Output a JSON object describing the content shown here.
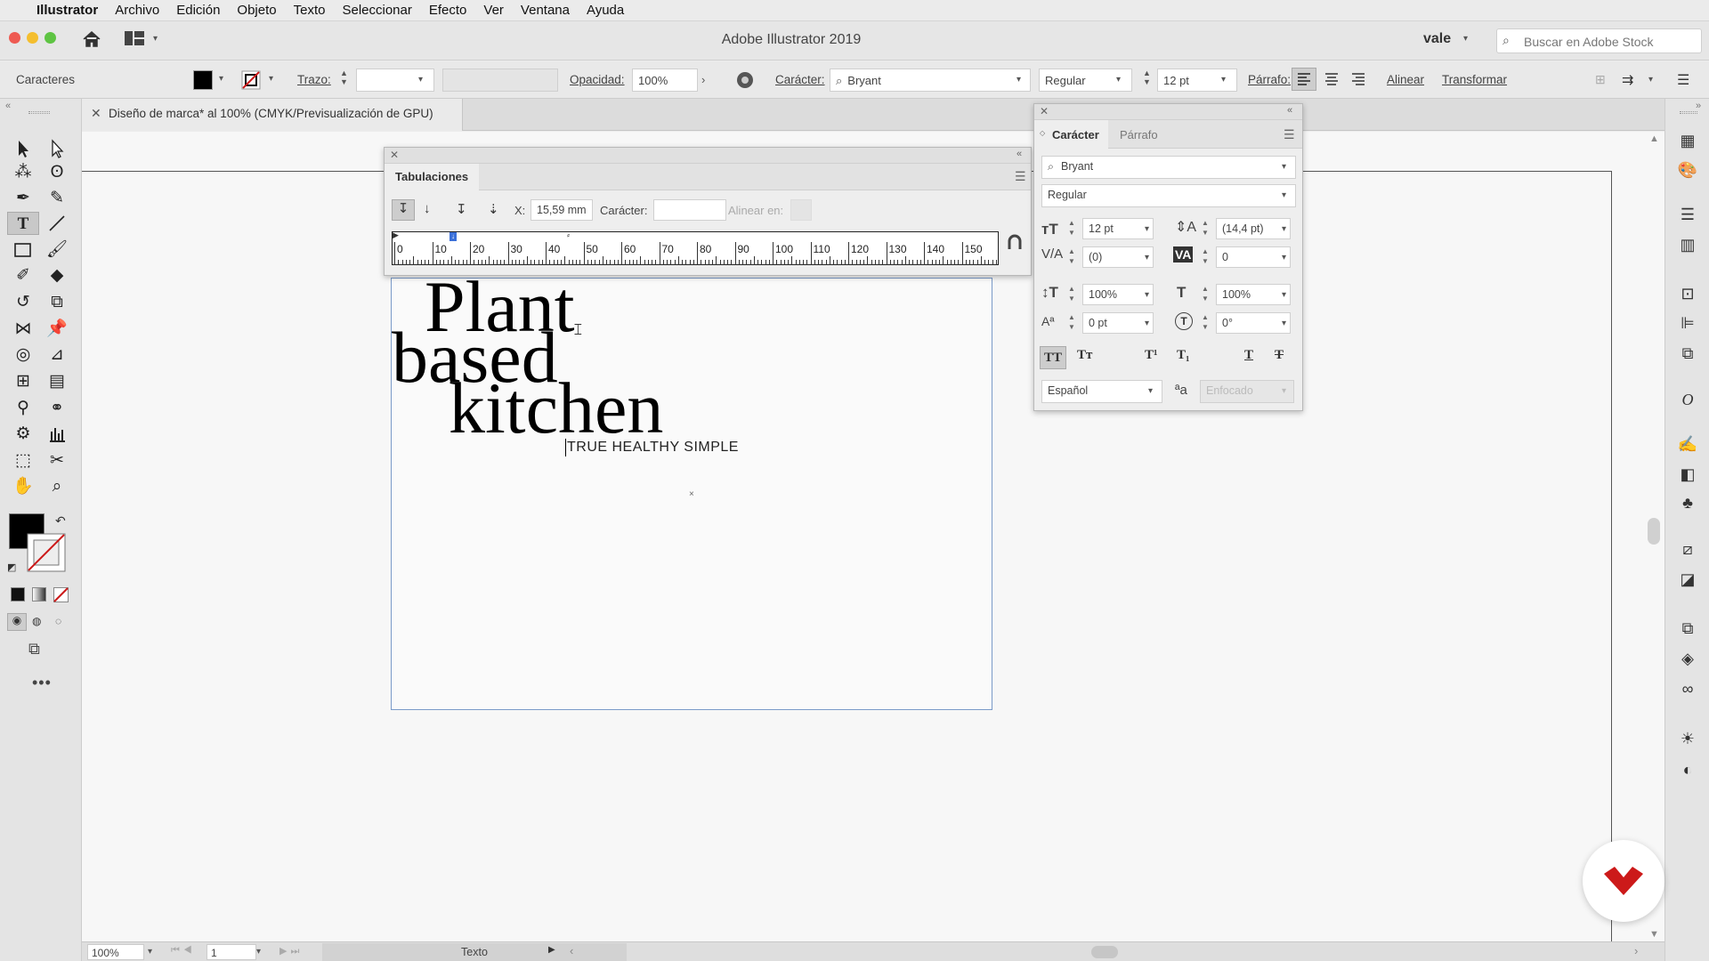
{
  "menubar": {
    "apple": "",
    "items": [
      "Illustrator",
      "Archivo",
      "Edición",
      "Objeto",
      "Texto",
      "Seleccionar",
      "Efecto",
      "Ver",
      "Ventana",
      "Ayuda"
    ]
  },
  "titlebar": {
    "title": "Adobe Illustrator 2019",
    "user": "vale",
    "search_placeholder": "Buscar en Adobe Stock"
  },
  "control": {
    "panel_name": "Caracteres",
    "stroke_label": "Trazo:",
    "opacity_label": "Opacidad:",
    "opacity_value": "100%",
    "character_label": "Carácter:",
    "font": "Bryant",
    "style": "Regular",
    "size": "12 pt",
    "paragraph_label": "Párrafo:",
    "align_label": "Alinear",
    "transform_label": "Transformar"
  },
  "document": {
    "tab_title": "Diseño de marca* al 100% (CMYK/Previsualización de GPU)"
  },
  "artwork": {
    "line1": "Plant",
    "line2": "based",
    "line3": "kitchen",
    "tagline": "TRUE HEALTHY SIMPLE"
  },
  "tabs_panel": {
    "title": "Tabulaciones",
    "x_label": "X:",
    "x_value": "15,59 mm",
    "char_label": "Carácter:",
    "char_value": "",
    "align_label": "Alinear en:",
    "ruler_labels": [
      "0",
      "10",
      "20",
      "30",
      "40",
      "50",
      "60",
      "70",
      "80",
      "90",
      "100",
      "110",
      "120",
      "130",
      "140",
      "150"
    ]
  },
  "char_panel": {
    "tab_character": "Carácter",
    "tab_paragraph": "Párrafo",
    "font": "Bryant",
    "style": "Regular",
    "size": "12 pt",
    "leading": "(14,4 pt)",
    "kerning": "(0)",
    "tracking": "0",
    "vscale": "100%",
    "hscale": "100%",
    "baseline": "0 pt",
    "rotation": "0°",
    "language": "Español",
    "antialias": "Enfocado"
  },
  "status": {
    "zoom": "100%",
    "page": "1",
    "tool": "Texto"
  },
  "colors": {
    "accent_red": "#cc1a1a",
    "artboard_border": "#7a9ac8"
  }
}
